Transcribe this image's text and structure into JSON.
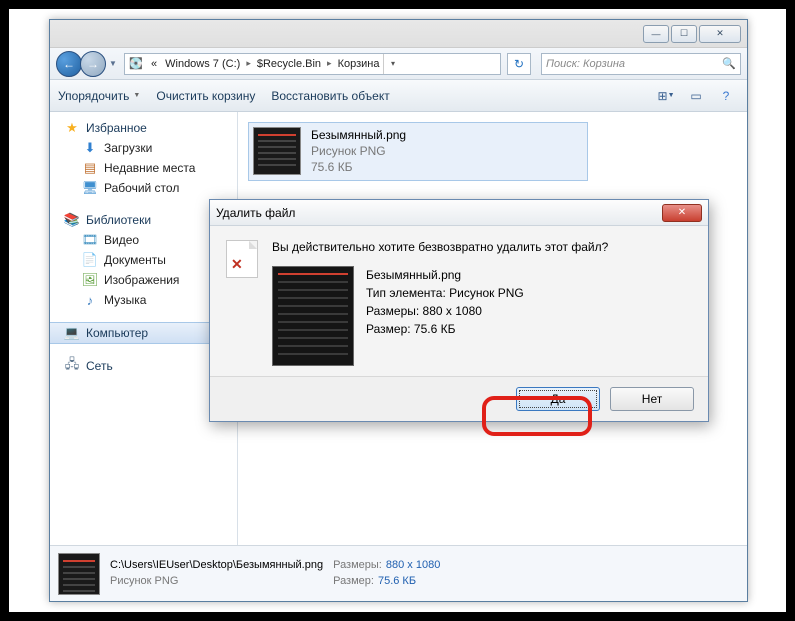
{
  "titlebar": {
    "min": "—",
    "max": "☐",
    "close": "✕"
  },
  "nav": {
    "breadcrumb": [
      "«",
      "Windows 7 (C:)",
      "$Recycle.Bin",
      "Корзина"
    ],
    "refresh": "↻",
    "search_placeholder": "Поиск: Корзина"
  },
  "toolbar": {
    "organize": "Упорядочить",
    "empty": "Очистить корзину",
    "restore": "Восстановить объект"
  },
  "sidebar": {
    "favorites": {
      "label": "Избранное",
      "items": [
        "Загрузки",
        "Недавние места",
        "Рабочий стол"
      ]
    },
    "libraries": {
      "label": "Библиотеки",
      "items": [
        "Видео",
        "Документы",
        "Изображения",
        "Музыка"
      ]
    },
    "computer": {
      "label": "Компьютер"
    },
    "network": {
      "label": "Сеть"
    }
  },
  "file": {
    "name": "Безымянный.png",
    "type": "Рисунок PNG",
    "size": "75.6 КБ"
  },
  "details": {
    "path": "C:\\Users\\IEUser\\Desktop\\Безымянный.png",
    "type": "Рисунок PNG",
    "dims_label": "Размеры:",
    "dims_value": "880 x 1080",
    "size_label": "Размер:",
    "size_value": "75.6 КБ"
  },
  "dialog": {
    "title": "Удалить файл",
    "question": "Вы действительно хотите безвозвратно удалить этот файл?",
    "file_name": "Безымянный.png",
    "type_label": "Тип элемента: Рисунок PNG",
    "dims": "Размеры: 880 x 1080",
    "size": "Размер: 75.6 КБ",
    "yes": "Да",
    "no": "Нет"
  }
}
